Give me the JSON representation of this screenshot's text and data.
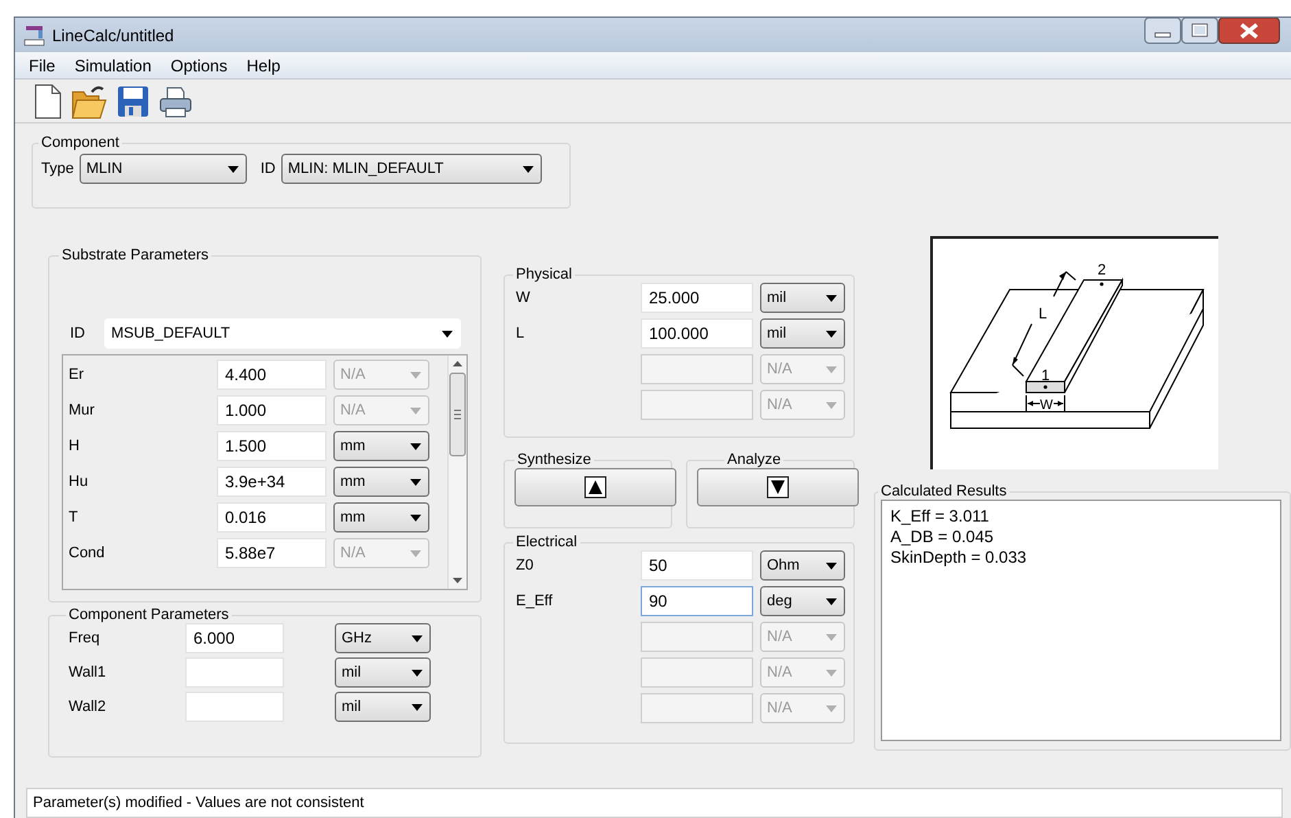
{
  "window": {
    "title": "LineCalc/untitled"
  },
  "menu": [
    {
      "label": "File"
    },
    {
      "label": "Simulation"
    },
    {
      "label": "Options"
    },
    {
      "label": "Help"
    }
  ],
  "component": {
    "title": "Component",
    "type_label": "Type",
    "type_value": "MLIN",
    "id_label": "ID",
    "id_value": "MLIN: MLIN_DEFAULT"
  },
  "substrate": {
    "title": "Substrate Parameters",
    "id_label": "ID",
    "id_value": "MSUB_DEFAULT",
    "rows": [
      {
        "label": "Er",
        "value": "4.400",
        "unit": "N/A",
        "unit_disabled": true
      },
      {
        "label": "Mur",
        "value": "1.000",
        "unit": "N/A",
        "unit_disabled": true
      },
      {
        "label": "H",
        "value": "1.500",
        "unit": "mm",
        "unit_disabled": false
      },
      {
        "label": "Hu",
        "value": "3.9e+34",
        "unit": "mm",
        "unit_disabled": false
      },
      {
        "label": "T",
        "value": "0.016",
        "unit": "mm",
        "unit_disabled": false
      },
      {
        "label": "Cond",
        "value": "5.88e7",
        "unit": "N/A",
        "unit_disabled": true
      }
    ]
  },
  "component_parameters": {
    "title": "Component Parameters",
    "rows": [
      {
        "label": "Freq",
        "value": "6.000",
        "unit": "GHz"
      },
      {
        "label": "Wall1",
        "unit": "mil"
      },
      {
        "label": "Wall2",
        "unit": "mil"
      }
    ]
  },
  "physical": {
    "title": "Physical",
    "rows": [
      {
        "label": "W",
        "value": "25.000",
        "unit": "mil",
        "disabled": false
      },
      {
        "label": "L",
        "value": "100.000",
        "unit": "mil",
        "disabled": false
      },
      {
        "unit": "N/A",
        "disabled": true
      },
      {
        "unit": "N/A",
        "disabled": true
      }
    ]
  },
  "synthesize": {
    "title": "Synthesize"
  },
  "analyze": {
    "title": "Analyze"
  },
  "electrical": {
    "title": "Electrical",
    "rows": [
      {
        "label": "Z0",
        "value": "50",
        "unit": "Ohm",
        "disabled": false,
        "focused": false
      },
      {
        "label": "E_Eff",
        "value": "90",
        "unit": "deg",
        "disabled": false,
        "focused": true
      },
      {
        "unit": "N/A",
        "disabled": true,
        "focused": false
      },
      {
        "unit": "N/A",
        "disabled": true,
        "focused": false
      },
      {
        "unit": "N/A",
        "disabled": true,
        "focused": false
      }
    ]
  },
  "diagram": {
    "length_label": "L",
    "width_label": "W",
    "port_1": "1",
    "port_2": "2"
  },
  "results": {
    "title": "Calculated Results",
    "lines": [
      "K_Eff = 3.011",
      "A_DB = 0.045",
      "SkinDepth = 0.033"
    ]
  },
  "status_bar": {
    "text": "Parameter(s) modified - Values are not consistent"
  }
}
